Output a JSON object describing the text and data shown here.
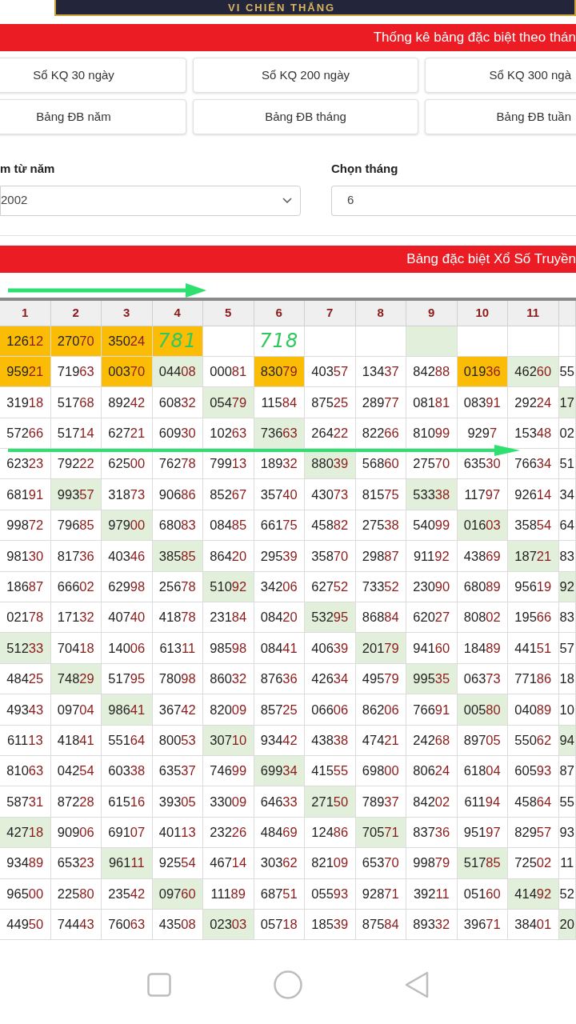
{
  "ad_banner": {
    "text": "VI CHIẾN THẮNG"
  },
  "section_title": "Thống kê bảng đặc biệt theo thán",
  "buttons": [
    {
      "label": "Sổ KQ 30 ngày"
    },
    {
      "label": "Sổ KQ 200 ngày"
    },
    {
      "label": "Sổ KQ 300 ngà"
    },
    {
      "label": "Bảng ĐB năm"
    },
    {
      "label": "Bảng ĐB tháng"
    },
    {
      "label": "Bảng ĐB tuần"
    }
  ],
  "filters": {
    "year_label": "m từ năm",
    "year_value": "2002",
    "month_label": "Chọn tháng",
    "month_value": "6"
  },
  "table_title": "Bảng đặc biệt Xổ Số Truyền",
  "table": {
    "columns": [
      "1",
      "2",
      "3",
      "4",
      "5",
      "6",
      "7",
      "8",
      "9",
      "10",
      "11",
      ""
    ],
    "rows": [
      [
        {
          "value": "12612",
          "color": "#fbbc05"
        },
        {
          "value": "27070",
          "color": "#fbbc05"
        },
        {
          "value": "35024",
          "color": "#fbbc05"
        },
        {
          "color": "#fbbc05"
        },
        {},
        {},
        {},
        {},
        {
          "color": "#e2efda"
        },
        {},
        {},
        {}
      ],
      [
        {
          "value": "95921",
          "color": "#fbbc05"
        },
        {
          "value": "71963"
        },
        {
          "value": "00370",
          "color": "#fbbc05"
        },
        {
          "value": "04408",
          "color": "#e2efda"
        },
        {
          "value": "00081"
        },
        {
          "value": "83079",
          "color": "#fbbc05"
        },
        {
          "value": "40357"
        },
        {
          "value": "13437"
        },
        {
          "value": "84288"
        },
        {
          "value": "01936",
          "color": "#fbbc05"
        },
        {
          "value": "46260",
          "color": "#e2efda"
        },
        {
          "value": "55"
        }
      ],
      [
        {
          "value": "31918"
        },
        {
          "value": "51768"
        },
        {
          "value": "89242"
        },
        {
          "value": "60832"
        },
        {
          "value": "05479",
          "color": "#e2efda"
        },
        {
          "value": "11584"
        },
        {
          "value": "87525"
        },
        {
          "value": "28977"
        },
        {
          "value": "08181"
        },
        {
          "value": "08391"
        },
        {
          "value": "29224"
        },
        {
          "value": "17",
          "color": "#e2efda"
        }
      ],
      [
        {
          "value": "57266"
        },
        {
          "value": "51714"
        },
        {
          "value": "62721"
        },
        {
          "value": "60930"
        },
        {
          "value": "10263"
        },
        {
          "value": "73663",
          "color": "#e2efda"
        },
        {
          "value": "26422"
        },
        {
          "value": "82266"
        },
        {
          "value": "81099"
        },
        {
          "value": "9297"
        },
        {
          "value": "15348"
        },
        {
          "value": "02"
        }
      ],
      [
        {
          "value": "62323"
        },
        {
          "value": "79222"
        },
        {
          "value": "62500"
        },
        {
          "value": "76278"
        },
        {
          "value": "79913"
        },
        {
          "value": "18932"
        },
        {
          "value": "88039",
          "color": "#e2efda"
        },
        {
          "value": "56860"
        },
        {
          "value": "27570"
        },
        {
          "value": "63530"
        },
        {
          "value": "76634"
        },
        {
          "value": "51"
        }
      ],
      [
        {
          "value": "68191"
        },
        {
          "value": "99357",
          "color": "#e2efda"
        },
        {
          "value": "31873"
        },
        {
          "value": "90686"
        },
        {
          "value": "85267"
        },
        {
          "value": "35740"
        },
        {
          "value": "43073"
        },
        {
          "value": "81575"
        },
        {
          "value": "53338",
          "color": "#e2efda"
        },
        {
          "value": "11797"
        },
        {
          "value": "92614"
        },
        {
          "value": "34"
        }
      ],
      [
        {
          "value": "99872"
        },
        {
          "value": "79685"
        },
        {
          "value": "97900",
          "color": "#e2efda"
        },
        {
          "value": "68083"
        },
        {
          "value": "08485"
        },
        {
          "value": "66175"
        },
        {
          "value": "45882"
        },
        {
          "value": "27538"
        },
        {
          "value": "54099"
        },
        {
          "value": "01603",
          "color": "#e2efda"
        },
        {
          "value": "35854"
        },
        {
          "value": "64"
        }
      ],
      [
        {
          "value": "98130"
        },
        {
          "value": "81736"
        },
        {
          "value": "40346"
        },
        {
          "value": "38585",
          "color": "#e2efda"
        },
        {
          "value": "86420"
        },
        {
          "value": "29539"
        },
        {
          "value": "35870"
        },
        {
          "value": "29887"
        },
        {
          "value": "91192"
        },
        {
          "value": "43869"
        },
        {
          "value": "18721",
          "color": "#e2efda"
        },
        {
          "value": "83"
        }
      ],
      [
        {
          "value": "18687"
        },
        {
          "value": "66602"
        },
        {
          "value": "62998"
        },
        {
          "value": "25678"
        },
        {
          "value": "51092",
          "color": "#e2efda"
        },
        {
          "value": "34206"
        },
        {
          "value": "62752"
        },
        {
          "value": "73352"
        },
        {
          "value": "23090"
        },
        {
          "value": "68089"
        },
        {
          "value": "95619"
        },
        {
          "value": "92",
          "color": "#e2efda"
        }
      ],
      [
        {
          "value": "02178"
        },
        {
          "value": "17132"
        },
        {
          "value": "40740"
        },
        {
          "value": "41878"
        },
        {
          "value": "23184"
        },
        {
          "value": "08420"
        },
        {
          "value": "53295",
          "color": "#e2efda"
        },
        {
          "value": "86884"
        },
        {
          "value": "62027"
        },
        {
          "value": "80802"
        },
        {
          "value": "19566"
        },
        {
          "value": "83"
        }
      ],
      [
        {
          "value": "51233",
          "color": "#e2efda"
        },
        {
          "value": "70418"
        },
        {
          "value": "14006"
        },
        {
          "value": "61311"
        },
        {
          "value": "98598"
        },
        {
          "value": "08441"
        },
        {
          "value": "40639"
        },
        {
          "value": "20179",
          "color": "#e2efda"
        },
        {
          "value": "94160"
        },
        {
          "value": "18489"
        },
        {
          "value": "44151"
        },
        {
          "value": "57"
        }
      ],
      [
        {
          "value": "48425"
        },
        {
          "value": "74829",
          "color": "#e2efda"
        },
        {
          "value": "51795"
        },
        {
          "value": "78098"
        },
        {
          "value": "86032"
        },
        {
          "value": "87636"
        },
        {
          "value": "42634"
        },
        {
          "value": "49579"
        },
        {
          "value": "99535",
          "color": "#e2efda"
        },
        {
          "value": "06373"
        },
        {
          "value": "77186"
        },
        {
          "value": "18"
        }
      ],
      [
        {
          "value": "49343"
        },
        {
          "value": "09704"
        },
        {
          "value": "98641",
          "color": "#e2efda"
        },
        {
          "value": "36742"
        },
        {
          "value": "82009"
        },
        {
          "value": "85725"
        },
        {
          "value": "06606"
        },
        {
          "value": "86206"
        },
        {
          "value": "76691"
        },
        {
          "value": "00580",
          "color": "#e2efda"
        },
        {
          "value": "04089"
        },
        {
          "value": "10"
        }
      ],
      [
        {
          "value": "61113"
        },
        {
          "value": "41841"
        },
        {
          "value": "55164"
        },
        {
          "value": "80053"
        },
        {
          "value": "30710",
          "color": "#e2efda"
        },
        {
          "value": "93442"
        },
        {
          "value": "43838"
        },
        {
          "value": "47421"
        },
        {
          "value": "24268"
        },
        {
          "value": "89705"
        },
        {
          "value": "55062"
        },
        {
          "value": "94",
          "color": "#e2efda"
        }
      ],
      [
        {
          "value": "81063"
        },
        {
          "value": "04254"
        },
        {
          "value": "60338"
        },
        {
          "value": "63537"
        },
        {
          "value": "74699"
        },
        {
          "value": "69934",
          "color": "#e2efda"
        },
        {
          "value": "41555"
        },
        {
          "value": "69800"
        },
        {
          "value": "80624"
        },
        {
          "value": "61804"
        },
        {
          "value": "60593"
        },
        {
          "value": "87"
        }
      ],
      [
        {
          "value": "58731"
        },
        {
          "value": "87228"
        },
        {
          "value": "61516"
        },
        {
          "value": "39305"
        },
        {
          "value": "33009"
        },
        {
          "value": "64633"
        },
        {
          "value": "27150",
          "color": "#e2efda"
        },
        {
          "value": "78937"
        },
        {
          "value": "84202"
        },
        {
          "value": "61194"
        },
        {
          "value": "45864"
        },
        {
          "value": "55"
        }
      ],
      [
        {
          "value": "42718",
          "color": "#e2efda"
        },
        {
          "value": "90906"
        },
        {
          "value": "69107"
        },
        {
          "value": "40113"
        },
        {
          "value": "23226"
        },
        {
          "value": "48469"
        },
        {
          "value": "12486"
        },
        {
          "value": "70571",
          "color": "#e2efda"
        },
        {
          "value": "83736"
        },
        {
          "value": "95197"
        },
        {
          "value": "82957"
        },
        {
          "value": "93"
        }
      ],
      [
        {
          "value": "93489"
        },
        {
          "value": "65323"
        },
        {
          "value": "96111",
          "color": "#e2efda"
        },
        {
          "value": "92554"
        },
        {
          "value": "46714"
        },
        {
          "value": "30362"
        },
        {
          "value": "82109"
        },
        {
          "value": "65370"
        },
        {
          "value": "99879"
        },
        {
          "value": "51785",
          "color": "#e2efda"
        },
        {
          "value": "72502"
        },
        {
          "value": "11"
        }
      ],
      [
        {
          "value": "96500"
        },
        {
          "value": "22580"
        },
        {
          "value": "23542"
        },
        {
          "value": "09760",
          "color": "#e2efda"
        },
        {
          "value": "11189"
        },
        {
          "value": "68751"
        },
        {
          "value": "05593"
        },
        {
          "value": "92871"
        },
        {
          "value": "39211"
        },
        {
          "value": "05160"
        },
        {
          "value": "41492",
          "color": "#e2efda"
        },
        {
          "value": "52"
        }
      ],
      [
        {
          "value": "44950"
        },
        {
          "value": "74443"
        },
        {
          "value": "76063"
        },
        {
          "value": "43508"
        },
        {
          "value": "02303",
          "color": "#e2efda"
        },
        {
          "value": "05718"
        },
        {
          "value": "18539"
        },
        {
          "value": "87584"
        },
        {
          "value": "89332"
        },
        {
          "value": "39671"
        },
        {
          "value": "38401"
        },
        {
          "value": "20",
          "color": "#e2efda"
        }
      ]
    ]
  },
  "handwriting": [
    "781",
    "718"
  ]
}
